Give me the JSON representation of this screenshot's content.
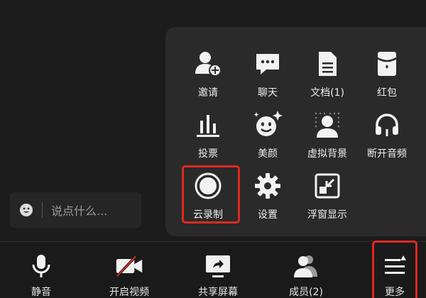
{
  "chat": {
    "placeholder": "说点什么..."
  },
  "more_panel": {
    "items": [
      {
        "label": "邀请",
        "icon": "invite-user-icon"
      },
      {
        "label": "聊天",
        "icon": "chat-bubble-icon"
      },
      {
        "label": "文档(1)",
        "icon": "document-icon"
      },
      {
        "label": "红包",
        "icon": "red-packet-icon"
      },
      {
        "label": "投票",
        "icon": "vote-bar-icon"
      },
      {
        "label": "美颜",
        "icon": "beauty-face-icon"
      },
      {
        "label": "虚拟背景",
        "icon": "virtual-background-icon"
      },
      {
        "label": "断开音频",
        "icon": "headphones-icon"
      },
      {
        "label": "云录制",
        "icon": "record-circle-icon",
        "highlighted": true
      },
      {
        "label": "设置",
        "icon": "gear-icon"
      },
      {
        "label": "浮窗显示",
        "icon": "floating-window-icon"
      }
    ]
  },
  "toolbar": {
    "items": [
      {
        "label": "静音",
        "icon": "microphone-icon"
      },
      {
        "label": "开启视频",
        "icon": "camera-off-icon"
      },
      {
        "label": "共享屏幕",
        "icon": "share-screen-icon"
      },
      {
        "label": "成员(2)",
        "icon": "members-icon"
      },
      {
        "label": "更多",
        "icon": "more-menu-icon",
        "highlighted": true
      }
    ]
  },
  "colors": {
    "highlight": "#e0281f",
    "background": "#1c1c1c",
    "panel": "#2a2a2a"
  }
}
